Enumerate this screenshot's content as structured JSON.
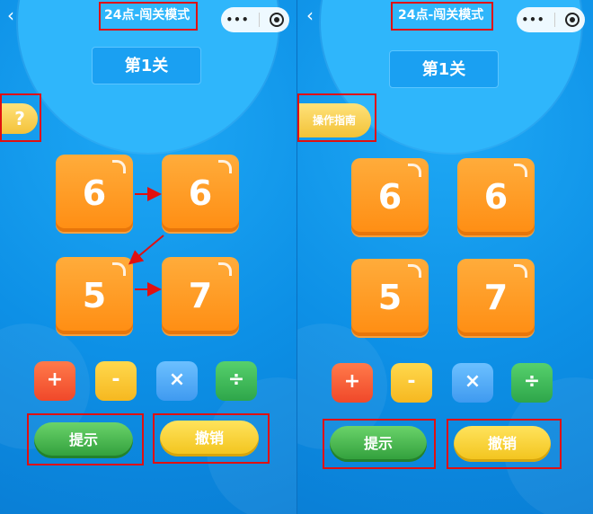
{
  "nav": {
    "back_icon": "chevron-left-icon",
    "title": "24点-闯关模式",
    "capsule_more": "•••"
  },
  "left_panel": {
    "level_label": "第1关",
    "help_label": "?",
    "cards": [
      "6",
      "6",
      "5",
      "7"
    ],
    "operators": [
      "+",
      "-",
      "×",
      "÷"
    ],
    "hint_label": "提示",
    "undo_label": "撤销"
  },
  "right_panel": {
    "level_label": "第1关",
    "guide_label": "操作指南",
    "cards": [
      "6",
      "6",
      "5",
      "7"
    ],
    "operators": [
      "+",
      "-",
      "×",
      "÷"
    ],
    "hint_label": "提示",
    "undo_label": "撤销"
  },
  "colors": {
    "background": "#0d8fe0",
    "card": "#ff9a22",
    "plus": "#f0482a",
    "minus": "#f6b820",
    "multiply": "#3f9af0",
    "divide": "#2ea64a",
    "hint": "#2f9d3a",
    "undo": "#f2c31b",
    "highlight_box": "#e01010"
  }
}
